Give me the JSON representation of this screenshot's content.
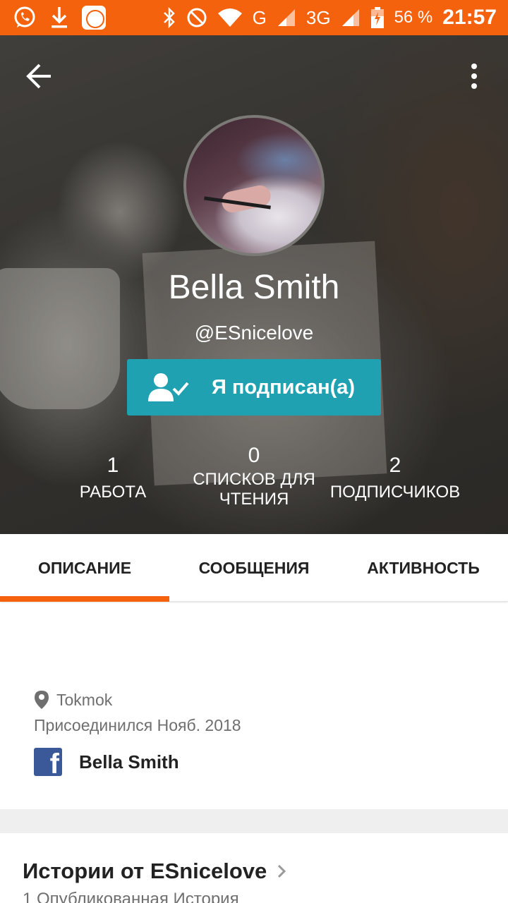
{
  "status_bar": {
    "network_g": "G",
    "network_3g": "3G",
    "battery_percent": "56 %",
    "time": "21:57",
    "icons": [
      "whatsapp-icon",
      "download-icon",
      "mi-icon",
      "bluetooth-icon",
      "dnd-icon",
      "wifi-icon",
      "signal-icon",
      "battery-icon"
    ]
  },
  "profile": {
    "name": "Bella Smith",
    "handle": "@ESnicelove",
    "follow_button_label": "Я подписан(а)",
    "stats": [
      {
        "value": "1",
        "label": "РАБОТА"
      },
      {
        "value": "0",
        "label_line1": "СПИСКОВ ДЛЯ",
        "label_line2": "ЧТЕНИЯ"
      },
      {
        "value": "2",
        "label": "ПОДПИСЧИКОВ"
      }
    ]
  },
  "tabs": [
    {
      "label": "ОПИСАНИЕ",
      "active": true
    },
    {
      "label": "СООБЩЕНИЯ",
      "active": false
    },
    {
      "label": "АКТИВНОСТЬ",
      "active": false
    }
  ],
  "description": {
    "location": "Tokmok",
    "joined": "Присоединился Нояб. 2018",
    "facebook_name": "Bella Smith"
  },
  "stories": {
    "title": "Истории от ESnicelove",
    "count": "1 Опубликованная История"
  },
  "colors": {
    "accent": "#f5620e",
    "follow_button": "#1fa1b1",
    "facebook": "#3b5998"
  }
}
